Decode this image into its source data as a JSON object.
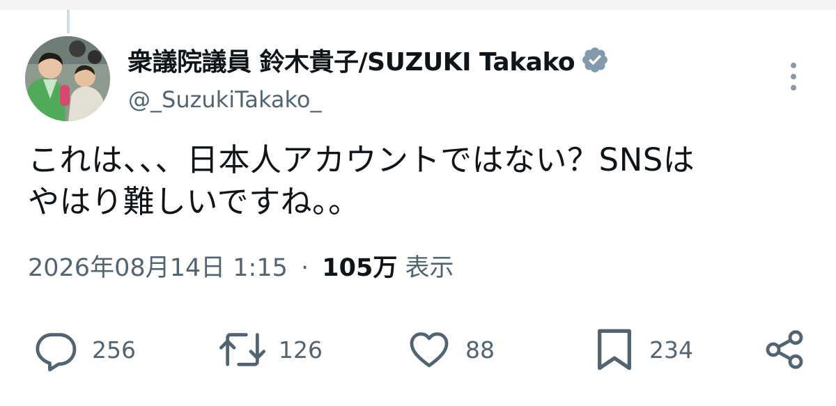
{
  "tweet": {
    "display_name": "衆議院議員 鈴木貴子/SUZUKI Takako",
    "handle": "@_SuzukiTakako_",
    "verified": true,
    "text_lines": [
      "これは、、、日本人アカウントではない？SNSは",
      "やはり難しいですね。。"
    ],
    "timestamp": "2026年08月14日 1:15",
    "separator": "·",
    "views_count": "105万",
    "views_label": "表示"
  },
  "actions": {
    "reply_count": "256",
    "retweet_count": "126",
    "like_count": "88",
    "bookmark_count": "234"
  },
  "icons": {
    "verified": "verified-badge-icon",
    "more": "more-vertical-icon",
    "reply": "reply-icon",
    "retweet": "retweet-icon",
    "like": "heart-icon",
    "bookmark": "bookmark-icon",
    "share": "share-icon"
  },
  "colors": {
    "text_primary": "#0f1419",
    "text_secondary": "#536471",
    "verified_badge": "#829aab"
  }
}
